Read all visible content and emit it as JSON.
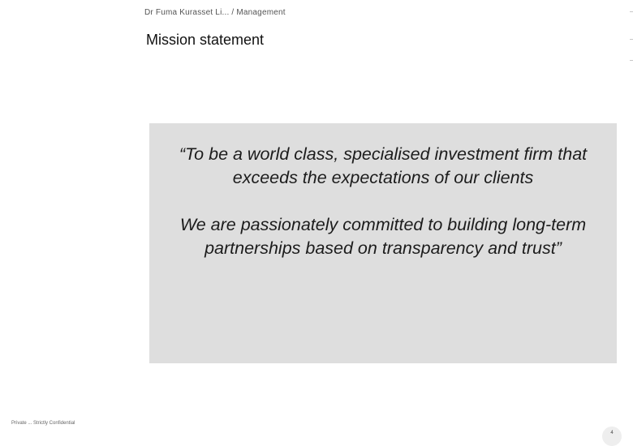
{
  "header": {
    "kicker": "Dr Fuma Kurasset Li... / Management",
    "title": "Mission statement"
  },
  "quote": {
    "line_1": "“To be a world class, specialised investment firm that exceeds the expectations of our clients",
    "line_2": "We are passionately committed to building long-term partnerships based on transparency and trust”"
  },
  "footer": {
    "note": "Private ... Strictly Confidential",
    "page_number": "4"
  }
}
